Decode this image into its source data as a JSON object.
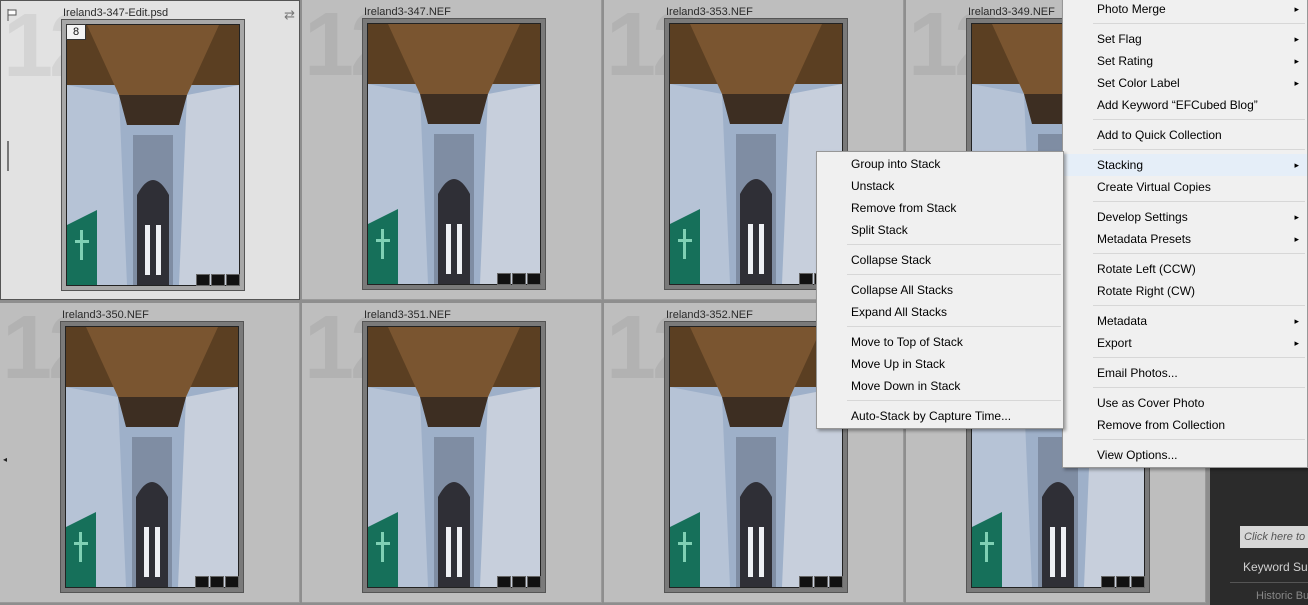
{
  "grid": {
    "cells": [
      {
        "filename": "Ireland3-347-Edit.psd",
        "stack_count": "8",
        "selected": true
      },
      {
        "filename": "Ireland3-347.NEF"
      },
      {
        "filename": "Ireland3-353.NEF"
      },
      {
        "filename": "Ireland3-349.NEF"
      },
      {
        "filename": "Ireland3-350.NEF"
      },
      {
        "filename": "Ireland3-351.NEF"
      },
      {
        "filename": "Ireland3-352.NEF"
      },
      {
        "filename": ""
      }
    ],
    "watermark_number": "12"
  },
  "context_menu": {
    "items": [
      {
        "label": "Photo Merge",
        "submenu": true
      },
      {
        "label": "Set Flag",
        "submenu": true
      },
      {
        "label": "Set Rating",
        "submenu": true
      },
      {
        "label": "Set Color Label",
        "submenu": true
      },
      {
        "label": "Add Keyword “EFCubed Blog”",
        "submenu": false
      },
      {
        "label": "Add to Quick Collection",
        "submenu": false
      },
      {
        "label": "Stacking",
        "submenu": true,
        "highlighted": true
      },
      {
        "label": "Create Virtual Copies",
        "submenu": false
      },
      {
        "label": "Develop Settings",
        "submenu": true
      },
      {
        "label": "Metadata Presets",
        "submenu": true
      },
      {
        "label": "Rotate Left (CCW)",
        "submenu": false
      },
      {
        "label": "Rotate Right (CW)",
        "submenu": false
      },
      {
        "label": "Metadata",
        "submenu": true
      },
      {
        "label": "Export",
        "submenu": true
      },
      {
        "label": "Email Photos...",
        "submenu": false
      },
      {
        "label": "Use as Cover Photo",
        "submenu": false
      },
      {
        "label": "Remove from Collection",
        "submenu": false
      },
      {
        "label": "View Options...",
        "submenu": false
      }
    ]
  },
  "stacking_submenu": {
    "items": [
      {
        "label": "Group into Stack"
      },
      {
        "label": "Unstack"
      },
      {
        "label": "Remove from Stack"
      },
      {
        "label": "Split Stack"
      },
      {
        "label": "Collapse Stack"
      },
      {
        "label": "Collapse All Stacks"
      },
      {
        "label": "Expand All Stacks"
      },
      {
        "label": "Move to Top of Stack"
      },
      {
        "label": "Move Up in Stack"
      },
      {
        "label": "Move Down in Stack"
      },
      {
        "label": "Auto-Stack by Capture Time..."
      }
    ]
  },
  "right_panel": {
    "keyword_placeholder": "Click here to a",
    "keyword_suggestions": "Keyword Sug",
    "historic": "Historic Bu"
  },
  "icons": {
    "arrow": "▸",
    "rotate": "⇄",
    "left": "◂"
  },
  "colors": {
    "menu_bg": "#f0f0f0",
    "highlight": "#e5eef8",
    "grid_bg": "#bebebe",
    "selected_bg": "#e2e2e2"
  }
}
